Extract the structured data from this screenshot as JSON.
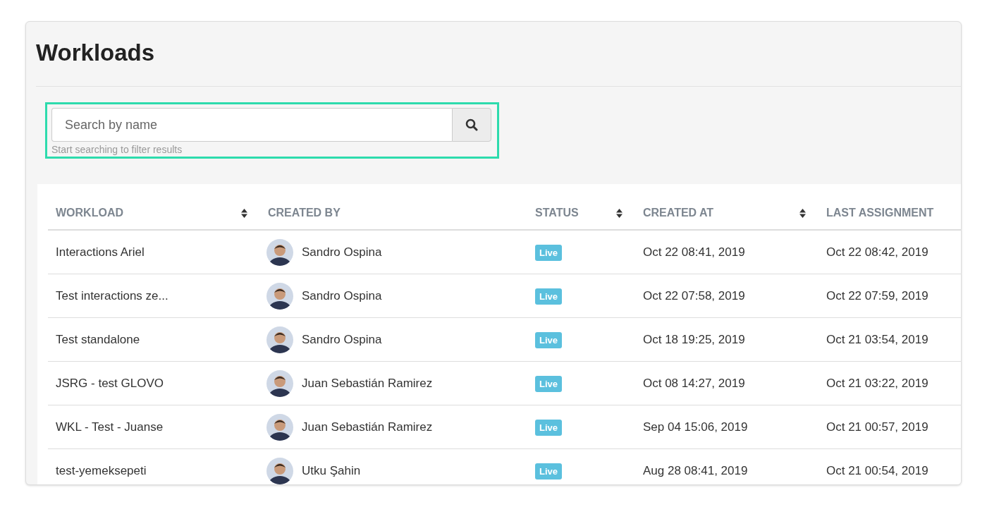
{
  "page": {
    "title": "Workloads"
  },
  "search": {
    "placeholder": "Search by name",
    "hint": "Start searching to filter results"
  },
  "table": {
    "columns": [
      {
        "label": "WORKLOAD",
        "sortable": true
      },
      {
        "label": "CREATED BY",
        "sortable": false
      },
      {
        "label": "STATUS",
        "sortable": true
      },
      {
        "label": "CREATED AT",
        "sortable": true
      },
      {
        "label": "LAST ASSIGNMENT",
        "sortable": false
      }
    ],
    "rows": [
      {
        "workload": "Interactions Ariel",
        "created_by": "Sandro Ospina",
        "status": "Live",
        "created_at": "Oct 22 08:41, 2019",
        "last_assignment": "Oct 22 08:42, 2019"
      },
      {
        "workload": "Test interactions ze...",
        "created_by": "Sandro Ospina",
        "status": "Live",
        "created_at": "Oct 22 07:58, 2019",
        "last_assignment": "Oct 22 07:59, 2019"
      },
      {
        "workload": "Test standalone",
        "created_by": "Sandro Ospina",
        "status": "Live",
        "created_at": "Oct 18 19:25, 2019",
        "last_assignment": "Oct 21 03:54, 2019"
      },
      {
        "workload": "JSRG - test GLOVO",
        "created_by": "Juan Sebastián Ramirez",
        "status": "Live",
        "created_at": "Oct 08 14:27, 2019",
        "last_assignment": "Oct 21 03:22, 2019"
      },
      {
        "workload": "WKL - Test - Juanse",
        "created_by": "Juan Sebastián Ramirez",
        "status": "Live",
        "created_at": "Sep 04 15:06, 2019",
        "last_assignment": "Oct 21 00:57, 2019"
      },
      {
        "workload": "test-yemeksepeti",
        "created_by": "Utku Şahin",
        "status": "Live",
        "created_at": "Aug 28 08:41, 2019",
        "last_assignment": "Oct 21 00:54, 2019"
      }
    ]
  }
}
